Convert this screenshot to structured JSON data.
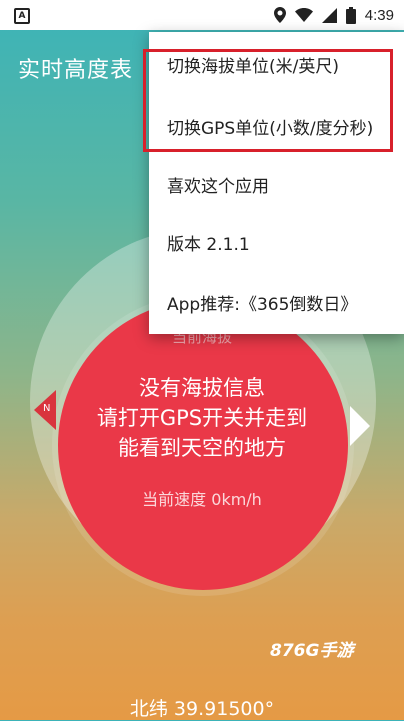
{
  "status_bar": {
    "time": "4:39",
    "app_icon": "A"
  },
  "app": {
    "title": "实时高度表"
  },
  "menu": {
    "items": [
      {
        "label": "切换海拔单位(米/英尺)"
      },
      {
        "label": "切换GPS单位(小数/度分秒)"
      },
      {
        "label": "喜欢这个应用"
      },
      {
        "label": "版本 2.1.1"
      },
      {
        "label": "App推荐:《365倒数日》"
      }
    ]
  },
  "dial": {
    "altitude_label": "当前海拔",
    "message_lines": [
      "没有海拔信息",
      "请打开GPS开关并走到",
      "能看到天空的地方"
    ],
    "speed": "当前速度 0km/h",
    "left_marker": "N"
  },
  "footer": {
    "latitude": "北纬 39.91500°"
  },
  "watermark": "876G手游",
  "colors": {
    "accent_red": "#ea3848",
    "highlight_red": "#d8202b"
  }
}
